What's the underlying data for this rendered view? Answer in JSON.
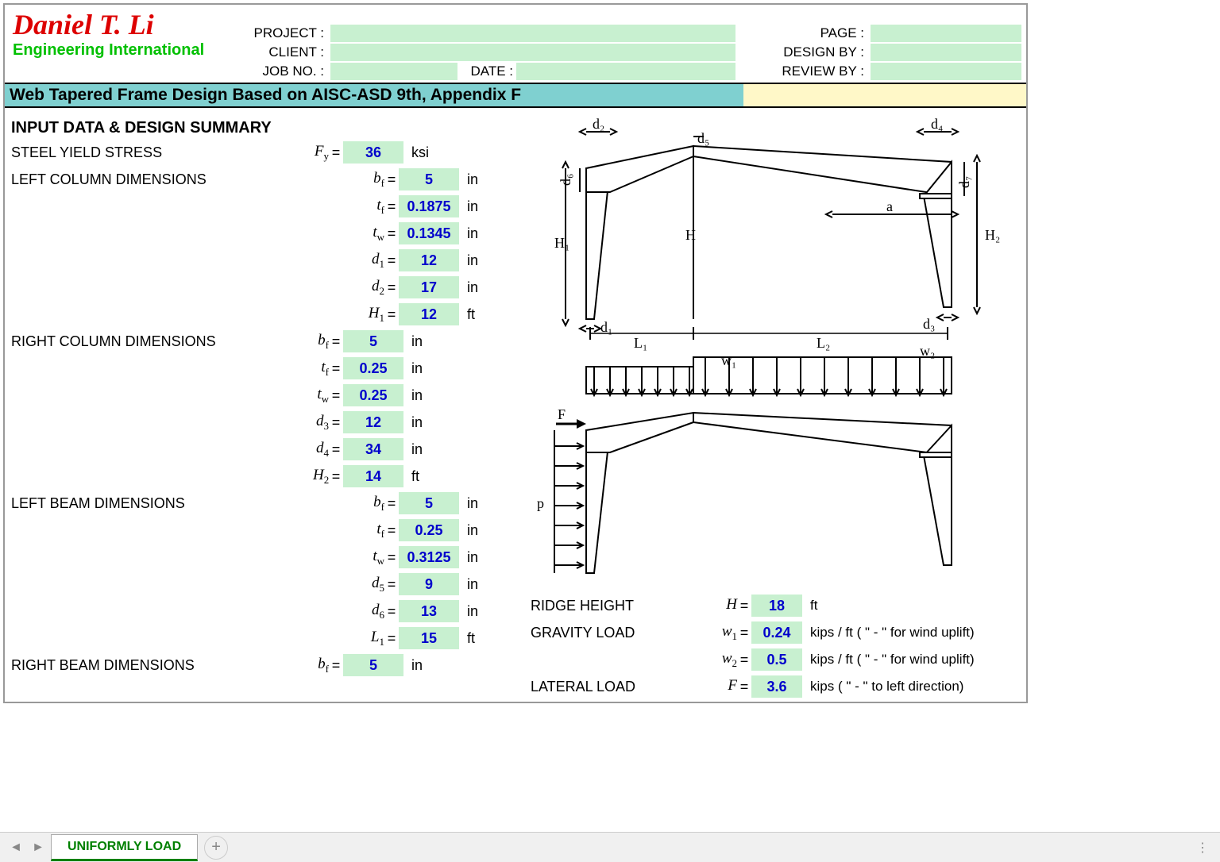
{
  "logo": {
    "name": "Daniel T. Li",
    "sub": "Engineering International"
  },
  "header": {
    "project_label": "PROJECT :",
    "client_label": "CLIENT :",
    "jobno_label": "JOB NO. :",
    "date_label": "DATE :",
    "page_label": "PAGE :",
    "designby_label": "DESIGN BY :",
    "reviewby_label": "REVIEW BY :"
  },
  "title": "Web Tapered Frame Design Based on AISC-ASD 9th, Appendix F",
  "section_title": "INPUT DATA & DESIGN SUMMARY",
  "steel_yield": {
    "label": "STEEL YIELD STRESS",
    "sym": "F",
    "sub": "y",
    "val": "36",
    "unit": "ksi"
  },
  "left_col": {
    "title": "LEFT COLUMN DIMENSIONS",
    "rows": [
      {
        "sym": "b",
        "sub": "f",
        "val": "5",
        "unit": "in"
      },
      {
        "sym": "t",
        "sub": "f",
        "val": "0.1875",
        "unit": "in"
      },
      {
        "sym": "t",
        "sub": "w",
        "val": "0.1345",
        "unit": "in"
      },
      {
        "sym": "d",
        "sub": "1",
        "val": "12",
        "unit": "in"
      },
      {
        "sym": "d",
        "sub": "2",
        "val": "17",
        "unit": "in"
      },
      {
        "sym": "H",
        "sub": "1",
        "val": "12",
        "unit": "ft"
      }
    ]
  },
  "right_col": {
    "title": "RIGHT COLUMN DIMENSIONS",
    "rows": [
      {
        "sym": "b",
        "sub": "f",
        "val": "5",
        "unit": "in"
      },
      {
        "sym": "t",
        "sub": "f",
        "val": "0.25",
        "unit": "in"
      },
      {
        "sym": "t",
        "sub": "w",
        "val": "0.25",
        "unit": "in"
      },
      {
        "sym": "d",
        "sub": "3",
        "val": "12",
        "unit": "in"
      },
      {
        "sym": "d",
        "sub": "4",
        "val": "34",
        "unit": "in"
      },
      {
        "sym": "H",
        "sub": "2",
        "val": "14",
        "unit": "ft"
      }
    ]
  },
  "left_beam": {
    "title": "LEFT BEAM DIMENSIONS",
    "rows": [
      {
        "sym": "b",
        "sub": "f",
        "val": "5",
        "unit": "in"
      },
      {
        "sym": "t",
        "sub": "f",
        "val": "0.25",
        "unit": "in"
      },
      {
        "sym": "t",
        "sub": "w",
        "val": "0.3125",
        "unit": "in"
      },
      {
        "sym": "d",
        "sub": "5",
        "val": "9",
        "unit": "in"
      },
      {
        "sym": "d",
        "sub": "6",
        "val": "13",
        "unit": "in"
      },
      {
        "sym": "L",
        "sub": "1",
        "val": "15",
        "unit": "ft"
      }
    ]
  },
  "right_beam": {
    "title": "RIGHT BEAM DIMENSIONS",
    "rows": [
      {
        "sym": "b",
        "sub": "f",
        "val": "5",
        "unit": "in"
      }
    ]
  },
  "right_inputs": [
    {
      "label": "RIDGE HEIGHT",
      "sym": "H",
      "sub": "",
      "val": "18",
      "unit": "ft"
    },
    {
      "label": "GRAVITY LOAD",
      "sym": "w",
      "sub": "1",
      "val": "0.24",
      "unit": "kips / ft ( \" - \" for wind uplift)"
    },
    {
      "label": "",
      "sym": "w",
      "sub": "2",
      "val": "0.5",
      "unit": "kips / ft ( \" - \" for wind uplift)"
    },
    {
      "label": "LATERAL LOAD",
      "sym": "F",
      "sub": "",
      "val": "3.6",
      "unit": "kips ( \" - \" to left direction)"
    }
  ],
  "diagram": {
    "labels": [
      "d₁",
      "d₂",
      "d₃",
      "d₄",
      "d₅",
      "d₆",
      "d₇",
      "H₁",
      "H₂",
      "H",
      "L₁",
      "L₂",
      "a",
      "w₁",
      "w₂",
      "F",
      "p"
    ]
  },
  "tab": {
    "name": "UNIFORMLY LOAD"
  }
}
